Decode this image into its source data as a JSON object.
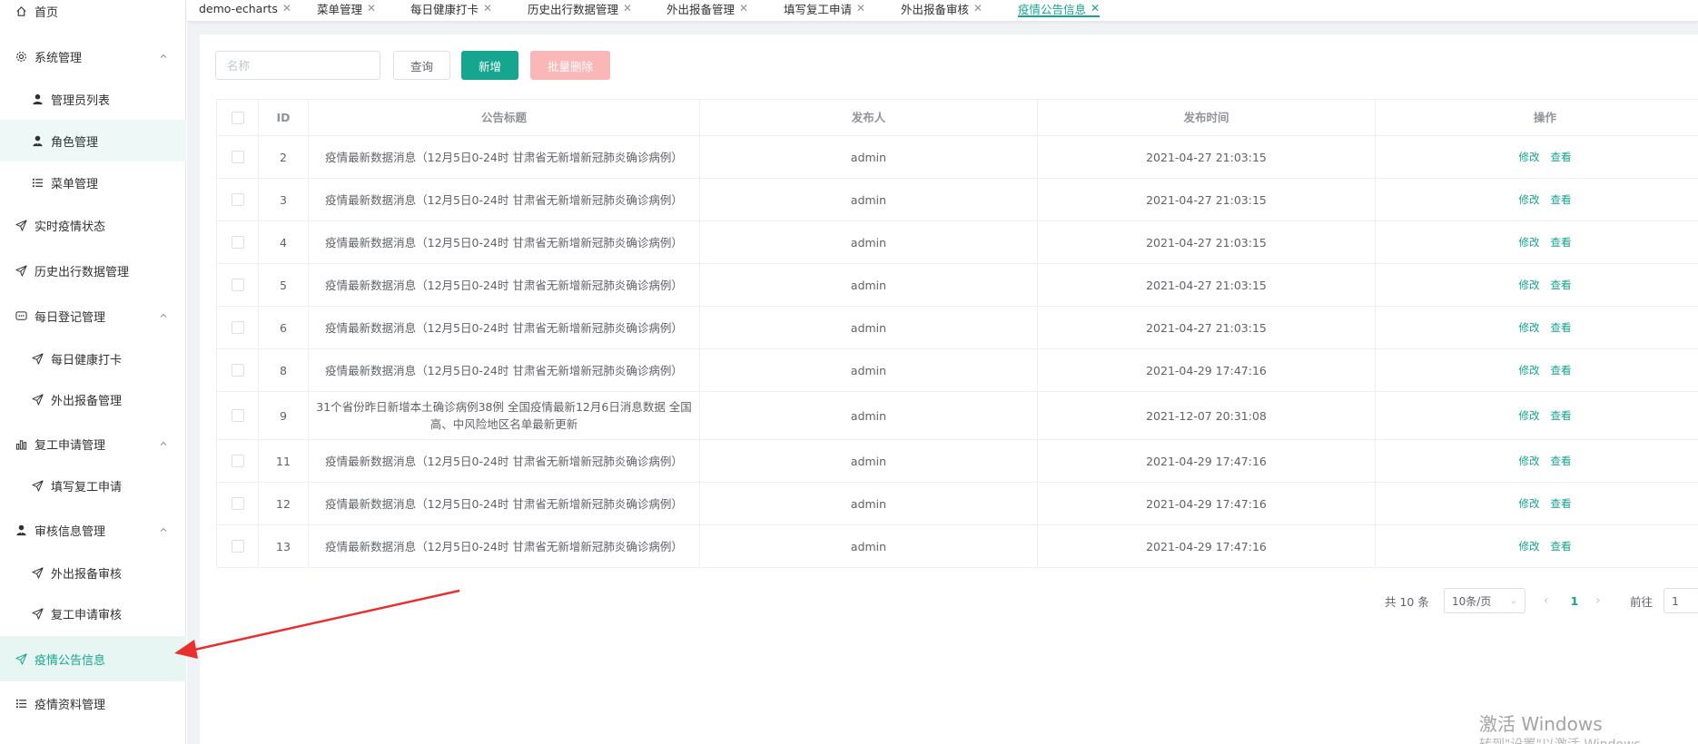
{
  "sidebar": {
    "items": [
      {
        "label": "首页",
        "icon": "home-icon"
      },
      {
        "label": "系统管理",
        "icon": "gear-icon",
        "expanded": true
      },
      {
        "label": "管理员列表",
        "icon": "user-icon"
      },
      {
        "label": "角色管理",
        "icon": "user-tie-icon"
      },
      {
        "label": "菜单管理",
        "icon": "list-icon"
      },
      {
        "label": "实时疫情状态",
        "icon": "paper-plane-icon"
      },
      {
        "label": "历史出行数据管理",
        "icon": "paper-plane-icon"
      },
      {
        "label": "每日登记管理",
        "icon": "chat-icon",
        "expanded": true
      },
      {
        "label": "每日健康打卡",
        "icon": "paper-plane-icon"
      },
      {
        "label": "外出报备管理",
        "icon": "paper-plane-icon"
      },
      {
        "label": "复工申请管理",
        "icon": "bar-chart-icon",
        "expanded": true
      },
      {
        "label": "填写复工申请",
        "icon": "paper-plane-icon"
      },
      {
        "label": "审核信息管理",
        "icon": "user-tie-icon",
        "expanded": true
      },
      {
        "label": "外出报备审核",
        "icon": "paper-plane-icon"
      },
      {
        "label": "复工申请审核",
        "icon": "paper-plane-icon"
      },
      {
        "label": "疫情公告信息",
        "icon": "paper-plane-icon",
        "active": true
      },
      {
        "label": "疫情资料管理",
        "icon": "list-icon"
      }
    ]
  },
  "tabs": [
    {
      "label": "demo-echarts"
    },
    {
      "label": "菜单管理"
    },
    {
      "label": "每日健康打卡"
    },
    {
      "label": "历史出行数据管理"
    },
    {
      "label": "外出报备管理"
    },
    {
      "label": "填写复工申请"
    },
    {
      "label": "外出报备审核"
    },
    {
      "label": "疫情公告信息",
      "active": true
    }
  ],
  "toolbar": {
    "search_placeholder": "名称",
    "query_label": "查询",
    "add_label": "新增",
    "batch_delete_label": "批量删除"
  },
  "table": {
    "headers": {
      "id": "ID",
      "title": "公告标题",
      "publisher": "发布人",
      "time": "发布时间",
      "actions": "操作"
    },
    "rows": [
      {
        "id": "2",
        "title": "疫情最新数据消息（12月5日0-24时 甘肃省无新增新冠肺炎确诊病例）",
        "publisher": "admin",
        "time": "2021-04-27 21:03:15"
      },
      {
        "id": "3",
        "title": "疫情最新数据消息（12月5日0-24时 甘肃省无新增新冠肺炎确诊病例）",
        "publisher": "admin",
        "time": "2021-04-27 21:03:15"
      },
      {
        "id": "4",
        "title": "疫情最新数据消息（12月5日0-24时 甘肃省无新增新冠肺炎确诊病例）",
        "publisher": "admin",
        "time": "2021-04-27 21:03:15"
      },
      {
        "id": "5",
        "title": "疫情最新数据消息（12月5日0-24时 甘肃省无新增新冠肺炎确诊病例）",
        "publisher": "admin",
        "time": "2021-04-27 21:03:15"
      },
      {
        "id": "6",
        "title": "疫情最新数据消息（12月5日0-24时 甘肃省无新增新冠肺炎确诊病例）",
        "publisher": "admin",
        "time": "2021-04-27 21:03:15"
      },
      {
        "id": "8",
        "title": "疫情最新数据消息（12月5日0-24时 甘肃省无新增新冠肺炎确诊病例）",
        "publisher": "admin",
        "time": "2021-04-29 17:47:16"
      },
      {
        "id": "9",
        "title": "31个省份昨日新增本土确诊病例38例 全国疫情最新12月6日消息数据 全国高、中风险地区名单最新更新",
        "publisher": "admin",
        "time": "2021-12-07 20:31:08"
      },
      {
        "id": "11",
        "title": "疫情最新数据消息（12月5日0-24时 甘肃省无新增新冠肺炎确诊病例）",
        "publisher": "admin",
        "time": "2021-04-29 17:47:16"
      },
      {
        "id": "12",
        "title": "疫情最新数据消息（12月5日0-24时 甘肃省无新增新冠肺炎确诊病例）",
        "publisher": "admin",
        "time": "2021-04-29 17:47:16"
      },
      {
        "id": "13",
        "title": "疫情最新数据消息（12月5日0-24时 甘肃省无新增新冠肺炎确诊病例）",
        "publisher": "admin",
        "time": "2021-04-29 17:47:16"
      }
    ],
    "edit_label": "修改",
    "view_label": "查看"
  },
  "pagination": {
    "total": "共 10 条",
    "page_size": "10条/页",
    "current_page": "1",
    "goto_label": "前往",
    "goto_value": "1"
  },
  "watermark": {
    "title": "激活 Windows",
    "subtitle": "转到\"设置\"以激活 Windows。"
  },
  "colors": {
    "accent": "#16a58e",
    "danger_light": "#f9b7b7",
    "annotation": "#e8312f"
  }
}
